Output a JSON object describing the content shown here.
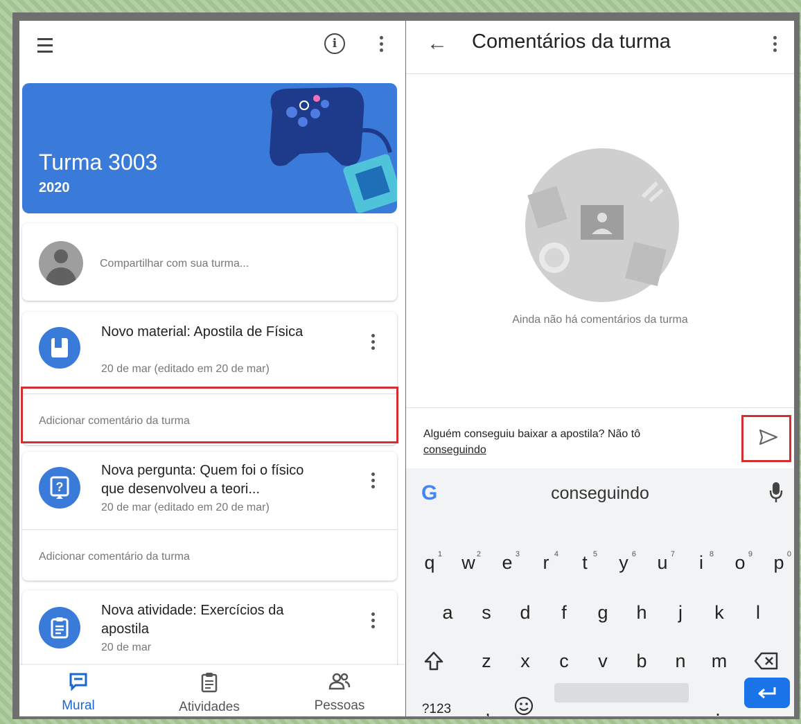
{
  "left": {
    "class_name": "Turma 3003",
    "class_year": "2020",
    "share_placeholder": "Compartilhar com sua turma...",
    "posts": [
      {
        "title": "Novo material: Apostila de Física",
        "date": "20 de mar (editado em 20 de mar)",
        "icon": "material-icon",
        "comment_placeholder": "Adicionar comentário da turma"
      },
      {
        "title": "Nova pergunta: Quem foi o físico que desenvolveu a teori...",
        "date": "20 de mar (editado em 20 de mar)",
        "icon": "question-icon",
        "comment_placeholder": "Adicionar comentário da turma"
      },
      {
        "title": "Nova atividade: Exercícios da apostila",
        "date": "20 de mar",
        "icon": "assignment-icon"
      }
    ],
    "nav": [
      {
        "label": "Mural",
        "icon": "stream-icon",
        "active": true
      },
      {
        "label": "Atividades",
        "icon": "classwork-icon",
        "active": false
      },
      {
        "label": "Pessoas",
        "icon": "people-icon",
        "active": false
      }
    ]
  },
  "right": {
    "title": "Comentários da turma",
    "empty_text": "Ainda não há comentários da turma",
    "compose_text": "Alguém conseguiu baixar a apostila? Não tô",
    "compose_underlined": "conseguindo",
    "keyboard": {
      "suggestion": "conseguindo",
      "row1": [
        "q",
        "w",
        "e",
        "r",
        "t",
        "y",
        "u",
        "i",
        "o",
        "p"
      ],
      "row1_hints": [
        "1",
        "2",
        "3",
        "4",
        "5",
        "6",
        "7",
        "8",
        "9",
        "0"
      ],
      "row2": [
        "a",
        "s",
        "d",
        "f",
        "g",
        "h",
        "j",
        "k",
        "l"
      ],
      "row3": [
        "z",
        "x",
        "c",
        "v",
        "b",
        "n",
        "m"
      ],
      "symbols_key": "?123",
      "comma_key": ",",
      "period_key": "."
    }
  },
  "colors": {
    "accent": "#1967d2",
    "banner": "#3a7bd9",
    "highlight": "#d32f2f"
  }
}
